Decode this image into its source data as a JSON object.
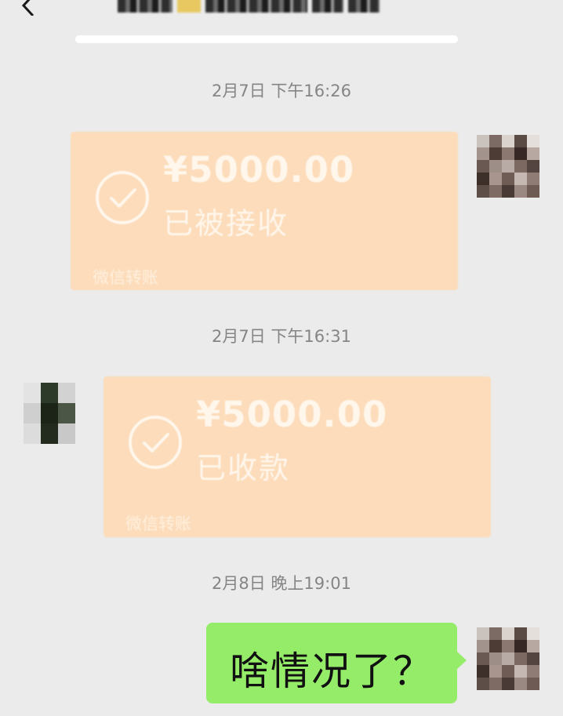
{
  "header": {
    "back_icon": "chevron-left-icon",
    "more_icon": "more-dots-icon"
  },
  "messages": [
    {
      "timestamp": "2月7日 下午16:26",
      "type": "transfer",
      "sender": "self",
      "amount": "¥5000.00",
      "status": "已被接收",
      "footer": "微信转账",
      "icon": "check-circle-icon"
    },
    {
      "timestamp": "2月7日 下午16:31",
      "type": "transfer",
      "sender": "other",
      "amount": "¥5000.00",
      "status": "已收款",
      "footer": "微信转账",
      "icon": "check-circle-icon"
    },
    {
      "timestamp": "2月8日 晚上19:01",
      "type": "text",
      "sender": "self",
      "text": "啥情况了？"
    }
  ],
  "colors": {
    "background": "#ebebeb",
    "transfer_card": "#fcdcba",
    "self_bubble": "#95ec69",
    "timestamp_text": "#858585"
  }
}
